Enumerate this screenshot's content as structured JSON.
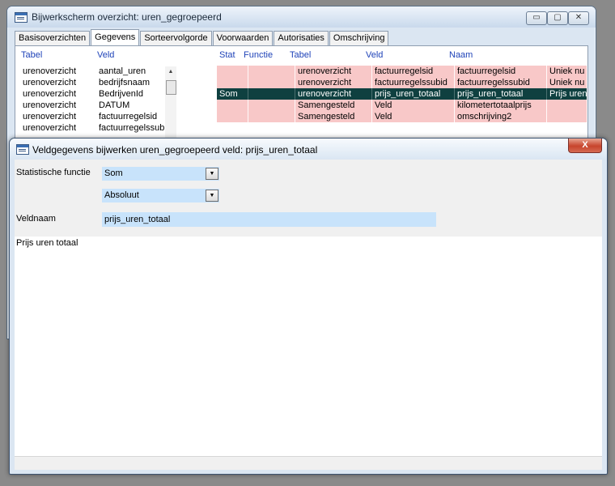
{
  "back_window": {
    "title": "Bijwerkscherm overzicht: uren_gegroepeerd",
    "controls": {
      "minimize": "▭",
      "maximize": "▢",
      "close": "✕"
    },
    "tabs": [
      "Basisoverzichten",
      "Gegevens",
      "Sorteervolgorde",
      "Voorwaarden",
      "Autorisaties",
      "Omschrijving"
    ],
    "field_headers": {
      "tabel": "Tabel",
      "veld": "Veld"
    },
    "field_list": [
      {
        "tabel": "urenoverzicht",
        "veld": "aantal_uren"
      },
      {
        "tabel": "urenoverzicht",
        "veld": "bedrijfsnaam"
      },
      {
        "tabel": "urenoverzicht",
        "veld": "BedrijvenId"
      },
      {
        "tabel": "urenoverzicht",
        "veld": "DATUM"
      },
      {
        "tabel": "urenoverzicht",
        "veld": "factuurregelsid"
      },
      {
        "tabel": "urenoverzicht",
        "veld": "factuurregelssubi"
      }
    ],
    "scroll_up_glyph": "▲",
    "grid_headers": {
      "stat": "Stat",
      "functie": "Functie",
      "tabel": "Tabel",
      "veld": "Veld",
      "naam": "Naam"
    },
    "grid_rows": [
      {
        "stat": "",
        "functie": "",
        "tabel": "urenoverzicht",
        "veld": "factuurregelsid",
        "naam": "factuurregelsid",
        "extra": "Uniek nu"
      },
      {
        "stat": "",
        "functie": "",
        "tabel": "urenoverzicht",
        "veld": "factuurregelssubid",
        "naam": "factuurregelssubid",
        "extra": "Uniek nu"
      },
      {
        "stat": "Som",
        "functie": "",
        "tabel": "urenoverzicht",
        "veld": "prijs_uren_totaal",
        "naam": "prijs_uren_totaal",
        "extra": "Prijs uren"
      },
      {
        "stat": "",
        "functie": "",
        "tabel": "Samengesteld",
        "veld": "Veld",
        "naam": "kilometertotaalprijs",
        "extra": ""
      },
      {
        "stat": "",
        "functie": "",
        "tabel": "Samengesteld",
        "veld": "Veld",
        "naam": "omschrijving2",
        "extra": ""
      }
    ]
  },
  "dialog": {
    "title": "Veldgegevens bijwerken uren_gegroepeerd veld: prijs_uren_totaal",
    "close_glyph": "X",
    "stat_function_label": "Statistische functie",
    "stat_function_value": "Som",
    "mode_value": "Absoluut",
    "dropdown_glyph": "▼",
    "fieldname_label": "Veldnaam",
    "fieldname_value": "prijs_uren_totaal",
    "description_text": "Prijs uren totaal"
  },
  "colors": {
    "grid_row": "#f8c8c8",
    "grid_selected": "#0f4040",
    "input_bg": "#c8e3fb",
    "header_text": "#1f43b8"
  }
}
